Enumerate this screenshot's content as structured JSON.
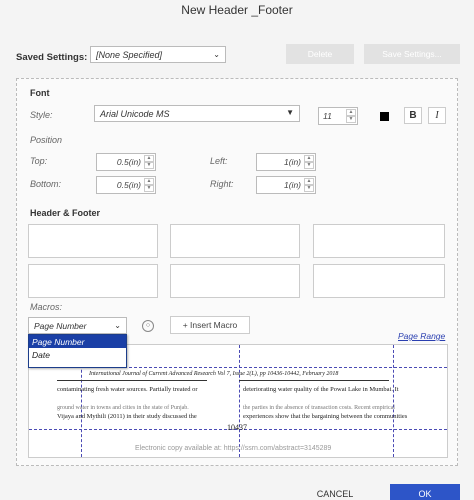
{
  "dialog": {
    "title": "New Header _Footer"
  },
  "saved": {
    "label": "Saved Settings:",
    "value": "[None Specified]",
    "delete_label": "Delete",
    "save_label": "Save Settings..."
  },
  "font": {
    "section": "Font",
    "style_label": "Style:",
    "style_value": "Arial Unicode MS",
    "size_value": "11",
    "bold_label": "B",
    "italic_label": "I"
  },
  "position": {
    "section": "Position",
    "top_label": "Top:",
    "top_value": "0.5",
    "top_unit": "(in)",
    "bottom_label": "Bottom:",
    "bottom_value": "0.5",
    "bottom_unit": "(in)",
    "left_label": "Left:",
    "left_value": "1",
    "left_unit": "(in)",
    "right_label": "Right:",
    "right_value": "1",
    "right_unit": "(in)"
  },
  "header_footer": {
    "section": "Header & Footer"
  },
  "macros": {
    "label": "Macros:",
    "selected": "Page Number",
    "insert_label": "+ Insert Macro",
    "options": [
      "Page Number",
      "Date"
    ]
  },
  "page_range": "Page Range",
  "preview": {
    "journal_line": "International Journal of Current Advanced Research Vol 7, Issue 2(L), pp 10436-10442, February 2018",
    "left_col_1": "contaminating fresh water sources. Partially treated or",
    "right_col_1": "deteriorating water quality of the Powai Lake in Mumbai. It",
    "left_col_2": "ground water in towns and cities in the state of Punjab.",
    "right_col_2": "the parties in the absence of transaction costs. Recent empirical",
    "left_col_3": "Vijaya and Mythili (2011) in their study discussed the",
    "right_col_3": "experiences show that the bargaining between the communities",
    "page_number": "10437",
    "footer_text": "Electronic copy available at: https://ssrn.com/abstract=3145289"
  },
  "buttons": {
    "cancel": "CANCEL",
    "ok": "OK"
  }
}
